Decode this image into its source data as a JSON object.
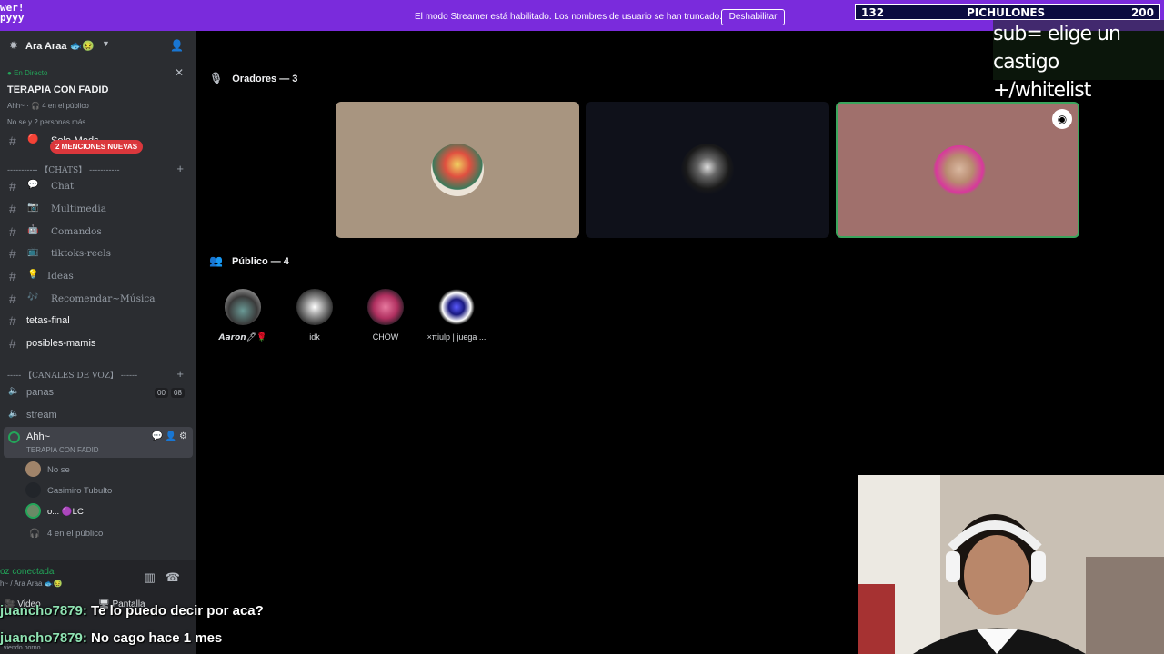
{
  "topbar": {
    "logo_line1": "wer!",
    "logo_line2": "pyyy",
    "message": "El modo Streamer está habilitado. Los nombres de usuario se han truncado.",
    "disable_label": "Deshabilitar"
  },
  "goal": {
    "current": "132",
    "title": "PICHULONES",
    "target": "200"
  },
  "overlay": {
    "line1": "sub= elige un castigo",
    "line2": "+/whitelist"
  },
  "server": {
    "name": "Ara Araa 🐟🤢"
  },
  "live": {
    "tag": "En Directo",
    "title": "TERAPIA CON FADID",
    "sub1": "Ahh~ · 🎧 4 en el público",
    "sub2": "No se y 2 personas más"
  },
  "partial_channel": "Solo-Mods",
  "mentions": "2 MENCIONES NUEVAS",
  "categories": {
    "chats": "----------- 【CHATS】 -----------",
    "voice": "----- 【CANALES DE VOZ】 ------"
  },
  "channels": [
    {
      "emoji": "💬",
      "label": "Chat"
    },
    {
      "emoji": "📷",
      "label": "Multimedia"
    },
    {
      "emoji": "🤖",
      "label": "Comandos"
    },
    {
      "emoji": "📺",
      "label": "tiktoks-reels"
    },
    {
      "emoji": "💡",
      "label": "Ideas"
    },
    {
      "emoji": "🎶",
      "label": "Recomendar~Música"
    },
    {
      "emoji": "",
      "label": "tetas-final"
    },
    {
      "emoji": "",
      "label": "posibles-mamis"
    }
  ],
  "voice_channels": [
    {
      "label": "panas",
      "count_a": "00",
      "count_b": "08"
    },
    {
      "label": "stream"
    }
  ],
  "active_voice": {
    "label": "Ahh~",
    "sub": "TERAPIA CON FADID"
  },
  "members": [
    {
      "label": "No se"
    },
    {
      "label": "Casimiro Tubulto"
    },
    {
      "label": "o... 🟣LC"
    },
    {
      "label": "4 en el público"
    }
  ],
  "panel": {
    "connected": "oz conectada",
    "sub": "h~ / Ara Araa 🐟🤢",
    "video": "Video",
    "screen": "Pantalla",
    "watching": "viendo porno"
  },
  "speakers_label": "Oradores — 3",
  "audience_label": "Público — 4",
  "audience": [
    {
      "label": "𝘼𝙖𝙧𝙤𝙣🖊🌹"
    },
    {
      "label": "idk"
    },
    {
      "label": "CHOW"
    },
    {
      "label": "×πiulp | juega ..."
    }
  ],
  "chat": [
    {
      "user": "juancho7879:",
      "text": " Te lo puedo decir por aca?"
    },
    {
      "user": "juancho7879:",
      "text": " No cago hace 1 mes"
    }
  ],
  "colors": {
    "accent": "#7a2bdc",
    "sidebar": "#2b2d31",
    "speaking_border": "#3ba55d",
    "chat_user": "#8fe2b2"
  }
}
